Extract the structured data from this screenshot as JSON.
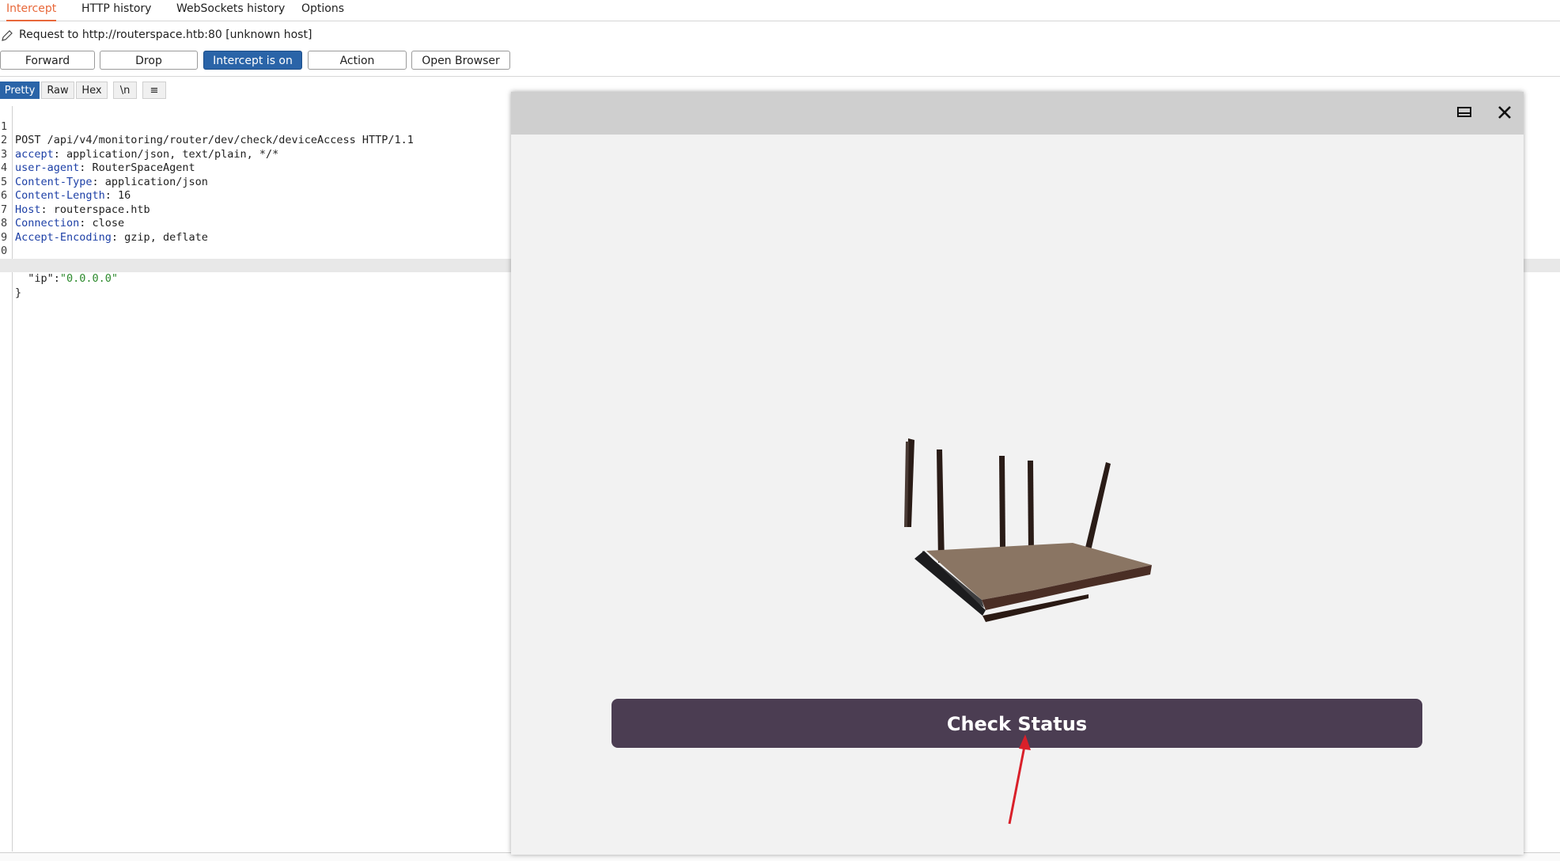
{
  "tabs": [
    {
      "label": "Intercept"
    },
    {
      "label": "HTTP history"
    },
    {
      "label": "WebSockets history"
    },
    {
      "label": "Options"
    }
  ],
  "request_info": "Request to http://routerspace.htb:80  [unknown host]",
  "toolbar": {
    "forward": "Forward",
    "drop": "Drop",
    "intercept": "Intercept is on",
    "action": "Action",
    "open_browser": "Open Browser"
  },
  "view_tabs": {
    "pretty": "Pretty",
    "raw": "Raw",
    "hex": "Hex",
    "newline": "\\n",
    "menu": "≡"
  },
  "request_lines": [
    {
      "num": "1",
      "name": "",
      "value": "POST /api/v4/monitoring/router/dev/check/deviceAccess HTTP/1.1"
    },
    {
      "num": "2",
      "name": "accept",
      "value": ": application/json, text/plain, */*"
    },
    {
      "num": "3",
      "name": "user-agent",
      "value": ": RouterSpaceAgent"
    },
    {
      "num": "4",
      "name": "Content-Type",
      "value": ": application/json"
    },
    {
      "num": "5",
      "name": "Content-Length",
      "value": ": 16"
    },
    {
      "num": "6",
      "name": "Host",
      "value": ": routerspace.htb"
    },
    {
      "num": "7",
      "name": "Connection",
      "value": ": close"
    },
    {
      "num": "8",
      "name": "Accept-Encoding",
      "value": ": gzip, deflate"
    },
    {
      "num": "9",
      "name": "",
      "value": ""
    },
    {
      "num": "0",
      "name": "",
      "value": "{"
    },
    {
      "num": "",
      "name": "  \"ip\":",
      "value": "\"0.0.0.0\""
    },
    {
      "num": "",
      "name": "",
      "value": "}"
    }
  ],
  "browser": {
    "restore_icon": "window-restore-icon",
    "close_icon": "close-icon",
    "button_label": "Check Status"
  },
  "colors": {
    "accent": "#e8683a",
    "intercept_on": "#2a64a8",
    "check_button": "#4b3d52",
    "arrow": "#d9202a"
  }
}
